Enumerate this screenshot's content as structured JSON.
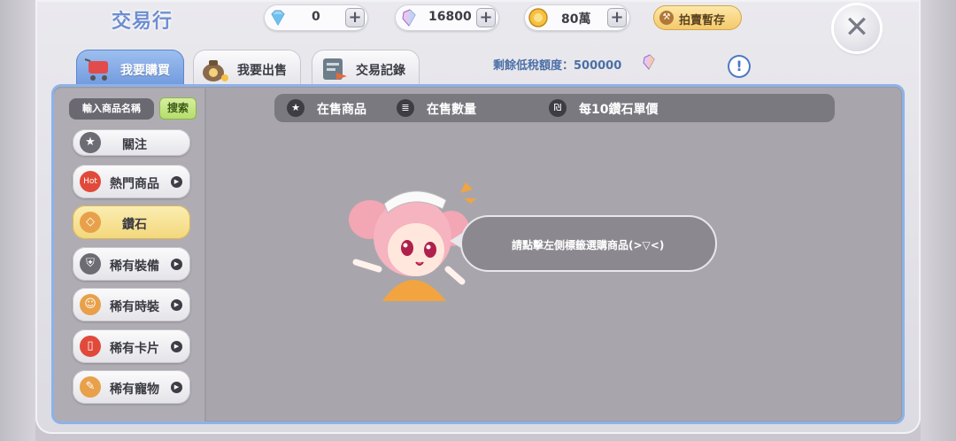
{
  "header": {
    "title": "交易行",
    "diamond_count": "0",
    "crystal_count": "16800",
    "zeny_count": "80萬",
    "auction_label": "拍賣暫存"
  },
  "tabs": [
    {
      "label": "我要購買",
      "active": true
    },
    {
      "label": "我要出售",
      "active": false
    },
    {
      "label": "交易記錄",
      "active": false
    }
  ],
  "tax": {
    "label": "剩餘低稅額度：500000"
  },
  "info_label": "!",
  "search": {
    "placeholder": "輸入商品名稱",
    "button_label": "搜索"
  },
  "categories": [
    {
      "label": "關注",
      "icon": "star-icon"
    },
    {
      "label": "熱門商品",
      "icon": "hot-icon"
    },
    {
      "label": "鑽石",
      "icon": "diamond-icon",
      "active": true
    },
    {
      "label": "稀有裝備",
      "icon": "armor-icon"
    },
    {
      "label": "稀有時裝",
      "icon": "costume-icon"
    },
    {
      "label": "稀有卡片",
      "icon": "card-icon"
    },
    {
      "label": "稀有寵物",
      "icon": "bone-icon"
    }
  ],
  "columns": [
    {
      "label": "在售商品",
      "icon": "star-icon"
    },
    {
      "label": "在售數量",
      "icon": "list-icon"
    },
    {
      "label": "每10鑽石單價",
      "icon": "price-icon"
    }
  ],
  "empty_message": "請點擊左側標籤選購商品(>▽<)",
  "colors": {
    "accent_blue": "#6e97dd",
    "active_yellow": "#f3d77b",
    "search_green": "#b2dc6a"
  }
}
